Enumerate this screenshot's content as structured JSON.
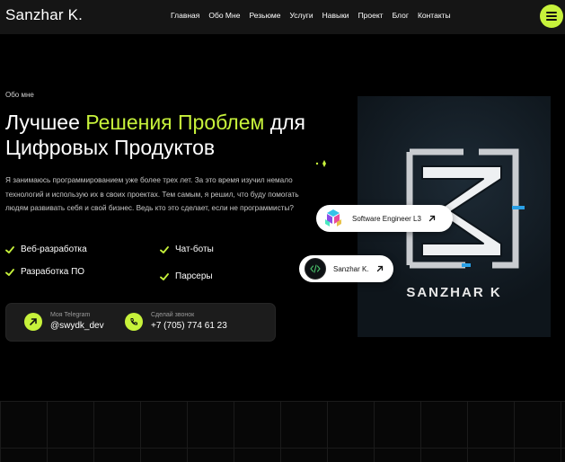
{
  "header": {
    "brand": "Sanzhar K.",
    "nav": [
      "Главная",
      "Обо Мне",
      "Резьюме",
      "Услуги",
      "Навыки",
      "Проект",
      "Блог",
      "Контакты"
    ]
  },
  "hero": {
    "eyebrow": "Обо мне",
    "headline_pre": "Лучшее ",
    "headline_highlight": "Решения Проблем",
    "headline_post": " для Цифровых Продуктов",
    "intro": "Я занимаюсь программированием уже более трех лет. За это время изучил немало технологий и использую их в своих проектах. Тем самым, я решил, что буду помогать людям развивать себя и свой бизнес. Ведь кто это сделает, если не программисты?",
    "skills": [
      "Веб-разработка",
      "Чат-боты",
      "Разработка ПО",
      "Парсеры"
    ]
  },
  "contact": {
    "telegram_label": "Моя Telegram",
    "telegram_value": "@swydk_dev",
    "phone_label": "Сделай звонок",
    "phone_value": "+7 (705) 774 61 23"
  },
  "profile": {
    "logo_text": "SANZHAR K",
    "badge1": "Software Engineer L3",
    "badge2": "Sanzhar K."
  },
  "colors": {
    "accent": "#c7f23b",
    "background": "#000000",
    "header": "#151515"
  }
}
